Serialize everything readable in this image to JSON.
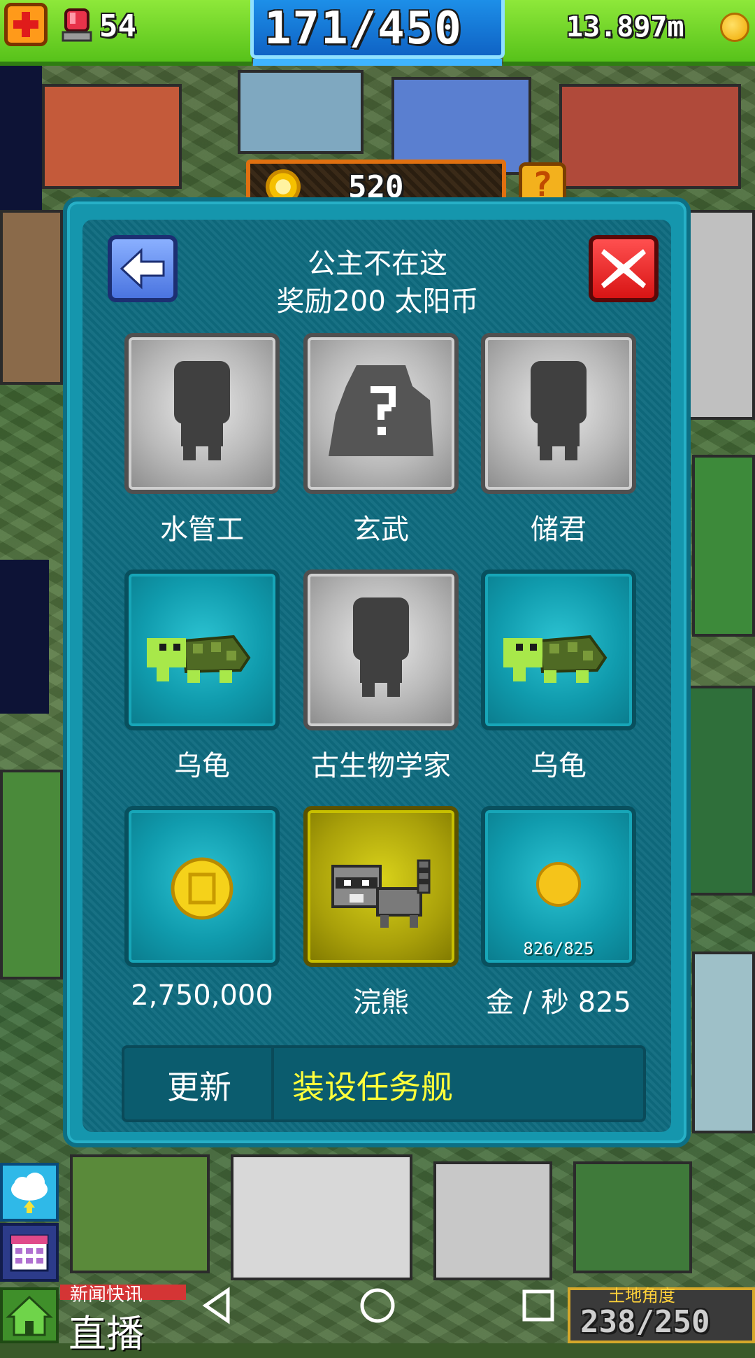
{
  "hud": {
    "siren_count": "54",
    "population": "171/450",
    "money": "13.897m"
  },
  "sun": {
    "value": "520",
    "help": "?"
  },
  "dialog": {
    "title_line1": "公主不在这",
    "title_line2": "奖励200 太阳币",
    "tiles": [
      {
        "label": "水管工",
        "state": "locked",
        "icon": "silhouette-person-icon"
      },
      {
        "label": "玄武",
        "state": "locked",
        "icon": "mystery-silhouette-icon"
      },
      {
        "label": "储君",
        "state": "locked",
        "icon": "silhouette-person-icon"
      },
      {
        "label": "乌龟",
        "state": "found",
        "icon": "turtle-icon"
      },
      {
        "label": "古生物学家",
        "state": "locked",
        "icon": "silhouette-person-icon"
      },
      {
        "label": "乌龟",
        "state": "found",
        "icon": "turtle-icon"
      },
      {
        "label": "2,750,000",
        "state": "reward",
        "icon": "coin-icon"
      },
      {
        "label": "浣熊",
        "state": "selected",
        "icon": "raccoon-icon"
      },
      {
        "label": "金 / 秒 825",
        "state": "reward",
        "icon": "coin-icon",
        "counter": "826/825"
      }
    ],
    "update_label": "更新",
    "task_label": "装设任务舰"
  },
  "bottom": {
    "news_small": "新闻快讯",
    "live_label": "直播",
    "land_small": "土地角度",
    "land_value": "238/250"
  },
  "colors": {
    "hud_green": "#6fd42a",
    "hud_blue": "#1a7ad8",
    "dialog_teal": "#1596ad",
    "task_yellow": "#ffff3a",
    "close_red": "#e01b1b",
    "back_blue": "#5a84ec"
  }
}
